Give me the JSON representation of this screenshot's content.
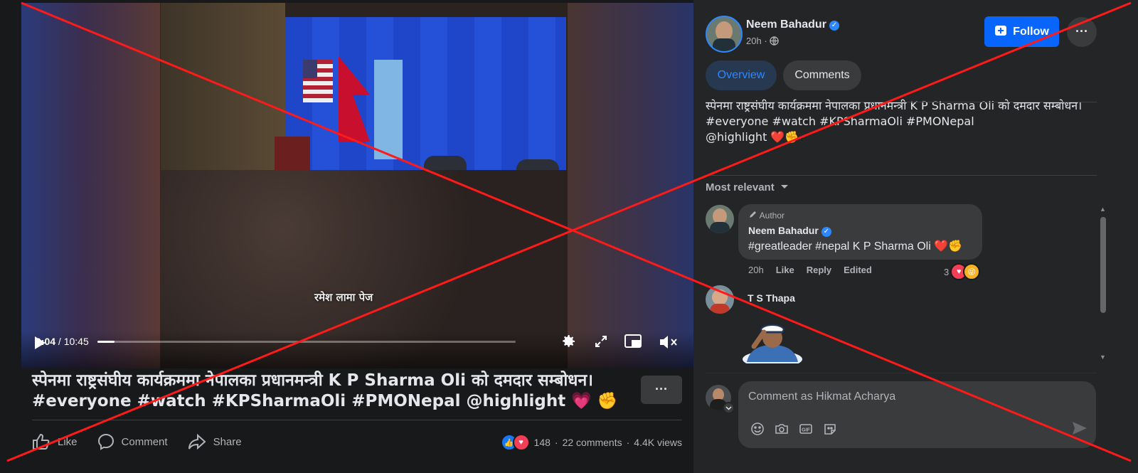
{
  "video": {
    "overlay_caption": "रमेश लामा पेज",
    "current_time": "0:04",
    "separator": " / ",
    "duration": "10:45",
    "progress": 0.04
  },
  "post": {
    "title": "स्पेनमा राष्ट्रसंघीय कार्यक्रममा नेपालका प्रधानमन्त्री K P Sharma Oli को दमदार सम्बोधन। #everyone #watch #KPSharmaOli #PMONepal @highlight 💗 ✊",
    "more_label": "···",
    "actions": {
      "like": "Like",
      "comment": "Comment",
      "share": "Share"
    },
    "stats": {
      "reactions": "148",
      "dot1": "·",
      "comments": "22 comments",
      "dot2": "·",
      "views": "4.4K views"
    }
  },
  "author": {
    "name": "Neem Bahadur",
    "time": "20h",
    "time_sep": "·",
    "follow_label": "Follow",
    "more_label": "···"
  },
  "tabs": {
    "overview": "Overview",
    "comments": "Comments"
  },
  "description": {
    "line1": "स्पेनमा राष्ट्रसंघीय कार्यक्रममा नेपालका प्रधानमन्त्री K P Sharma Oli को दमदार सम्बोधन।",
    "line2": "#everyone #watch #KPSharmaOli #PMONepal",
    "line3": "@highlight ❤️✊"
  },
  "sort_label": "Most relevant",
  "comments": [
    {
      "badge": "Author",
      "name": "Neem Bahadur",
      "text": "#greatleader #nepal K P Sharma Oli ❤️✊",
      "time": "20h",
      "like": "Like",
      "reply": "Reply",
      "edited": "Edited",
      "reaction_count": "3"
    },
    {
      "name": "T S Thapa"
    }
  ],
  "composer": {
    "placeholder": "Comment as Hikmat Acharya"
  },
  "colors": {
    "accent": "#0866ff",
    "like_blue": "#1877f2",
    "love_red": "#f33e58",
    "x_red": "#ff1a1a"
  }
}
